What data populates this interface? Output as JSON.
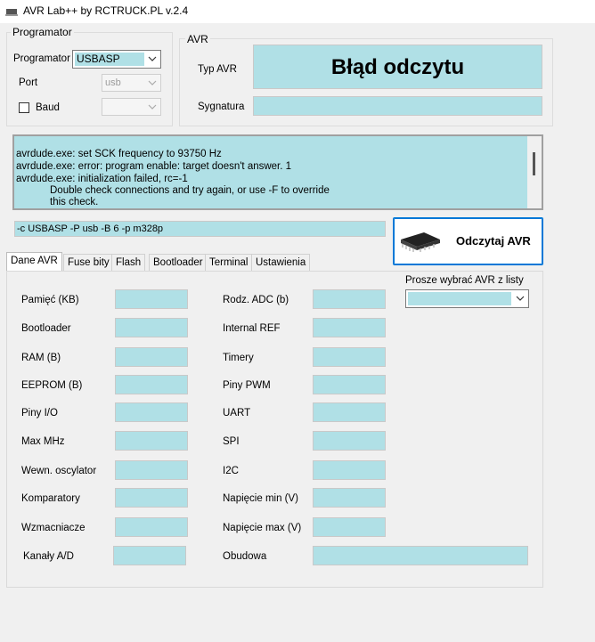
{
  "window": {
    "title": "AVR Lab++ by RCTRUCK.PL v.2.4"
  },
  "programmer_group": {
    "legend": "Programator",
    "programmer_label": "Programator",
    "programmer_value": "USBASP",
    "port_label": "Port",
    "port_value": "usb",
    "baud_label": "Baud",
    "baud_value": ""
  },
  "avr_group": {
    "legend": "AVR",
    "type_label": "Typ AVR",
    "type_value": "Błąd odczytu",
    "signature_label": "Sygnatura",
    "signature_value": ""
  },
  "log": {
    "lines": [
      "avrdude.exe: set SCK frequency to 93750 Hz",
      "avrdude.exe: error: program enable: target doesn't answer. 1",
      "avrdude.exe: initialization failed, rc=-1",
      "Double check connections and try again, or use -F to override",
      "this check."
    ]
  },
  "command": {
    "value": "-c USBASP -P usb -B 6  -p m328p"
  },
  "read_button": {
    "label": "Odczytaj AVR"
  },
  "tabs": [
    {
      "label": "Dane AVR",
      "active": true
    },
    {
      "label": "Fuse bity"
    },
    {
      "label": "Flash"
    },
    {
      "label": "Bootloader"
    },
    {
      "label": "Terminal"
    },
    {
      "label": "Ustawienia"
    }
  ],
  "select_avr": {
    "label": "Prosze wybrać AVR z listy",
    "value": ""
  },
  "fields_left": [
    {
      "label": "Pamięć (KB)",
      "value": ""
    },
    {
      "label": "Bootloader",
      "value": ""
    },
    {
      "label": "RAM (B)",
      "value": ""
    },
    {
      "label": "EEPROM (B)",
      "value": ""
    },
    {
      "label": "Piny I/O",
      "value": ""
    },
    {
      "label": "Max MHz",
      "value": ""
    },
    {
      "label": "Wewn. oscylator",
      "value": ""
    },
    {
      "label": "Komparatory",
      "value": ""
    },
    {
      "label": "Wzmacniacze",
      "value": ""
    },
    {
      "label": "Kanały A/D",
      "value": ""
    }
  ],
  "fields_right": [
    {
      "label": "Rodz. ADC (b)",
      "value": ""
    },
    {
      "label": "Internal REF",
      "value": ""
    },
    {
      "label": "Timery",
      "value": ""
    },
    {
      "label": "Piny PWM",
      "value": ""
    },
    {
      "label": "UART",
      "value": ""
    },
    {
      "label": "SPI",
      "value": ""
    },
    {
      "label": "I2C",
      "value": ""
    },
    {
      "label": "Napięcie min (V)",
      "value": ""
    },
    {
      "label": "Napięcie max (V)",
      "value": ""
    },
    {
      "label": "Obudowa",
      "value": ""
    }
  ]
}
